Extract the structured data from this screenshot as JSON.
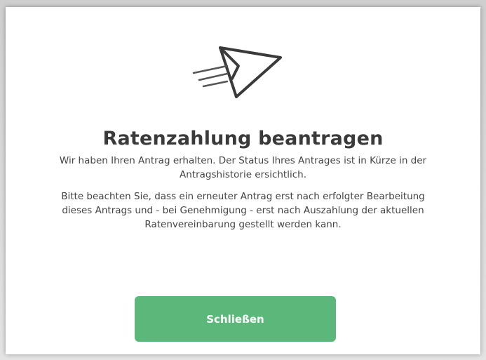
{
  "dialog": {
    "icon": "paper-plane-send-icon",
    "title": "Ratenzahlung beantragen",
    "message_1": "Wir haben Ihren Antrag erhalten. Der Status Ihres Antrages ist in Kürze in der Antragshistorie ersichtlich.",
    "message_2": "Bitte beachten Sie, dass ein erneuter Antrag erst nach erfolgter Bearbeitung dieses Antrags und - bei Genehmigung - erst nach Auszahlung der aktuellen Ratenvereinbarung gestellt werden kann.",
    "close_button_label": "Schließen"
  },
  "colors": {
    "button_background": "#5cb87a",
    "button_text": "#ffffff",
    "title_text": "#3a3a3a",
    "body_text": "#444444",
    "icon_stroke": "#3a3a3a"
  }
}
